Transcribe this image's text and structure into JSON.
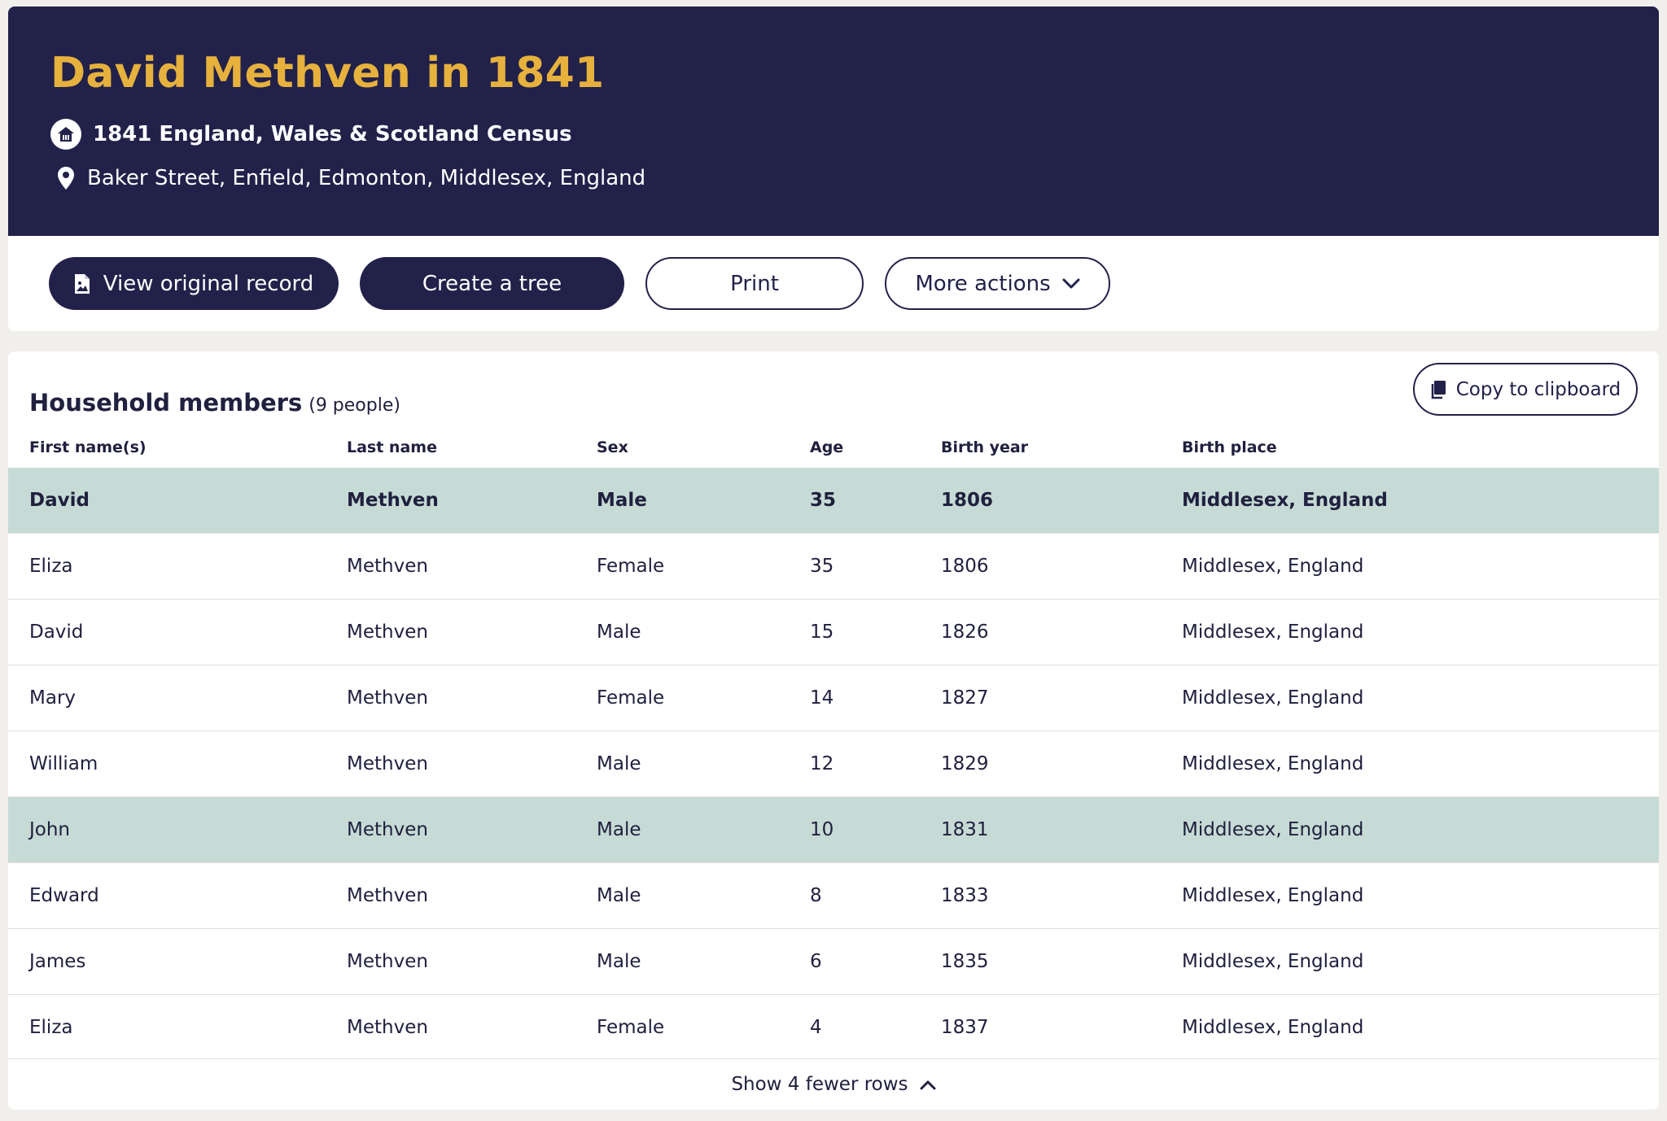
{
  "header": {
    "title": "David Methven in 1841",
    "collection": "1841 England, Wales & Scotland Census",
    "location": "Baker Street, Enfield, Edmonton, Middlesex, England"
  },
  "actions": {
    "view_original": "View original record",
    "create_tree": "Create a tree",
    "print": "Print",
    "more_actions": "More actions"
  },
  "household": {
    "title": "Household members",
    "count": "(9 people)",
    "copy_label": "Copy to clipboard",
    "columns": [
      "First name(s)",
      "Last name",
      "Sex",
      "Age",
      "Birth year",
      "Birth place"
    ],
    "rows": [
      [
        "David",
        "Methven",
        "Male",
        "35",
        "1806",
        "Middlesex, England"
      ],
      [
        "Eliza",
        "Methven",
        "Female",
        "35",
        "1806",
        "Middlesex, England"
      ],
      [
        "David",
        "Methven",
        "Male",
        "15",
        "1826",
        "Middlesex, England"
      ],
      [
        "Mary",
        "Methven",
        "Female",
        "14",
        "1827",
        "Middlesex, England"
      ],
      [
        "William",
        "Methven",
        "Male",
        "12",
        "1829",
        "Middlesex, England"
      ],
      [
        "John",
        "Methven",
        "Male",
        "10",
        "1831",
        "Middlesex, England"
      ],
      [
        "Edward",
        "Methven",
        "Male",
        "8",
        "1833",
        "Middlesex, England"
      ],
      [
        "James",
        "Methven",
        "Male",
        "6",
        "1835",
        "Middlesex, England"
      ],
      [
        "Eliza",
        "Methven",
        "Female",
        "4",
        "1837",
        "Middlesex, England"
      ]
    ],
    "show_fewer": "Show 4 fewer rows"
  },
  "colors": {
    "navy": "#22214a",
    "gold": "#e6b13d",
    "row_highlight": "#c6dbd5"
  },
  "icons": {
    "collection": "house-icon",
    "location": "map-pin-icon",
    "view_original": "document-image-icon",
    "more_actions": "chevron-down-icon",
    "copy": "clipboard-icon",
    "show_fewer": "chevron-up-icon"
  }
}
